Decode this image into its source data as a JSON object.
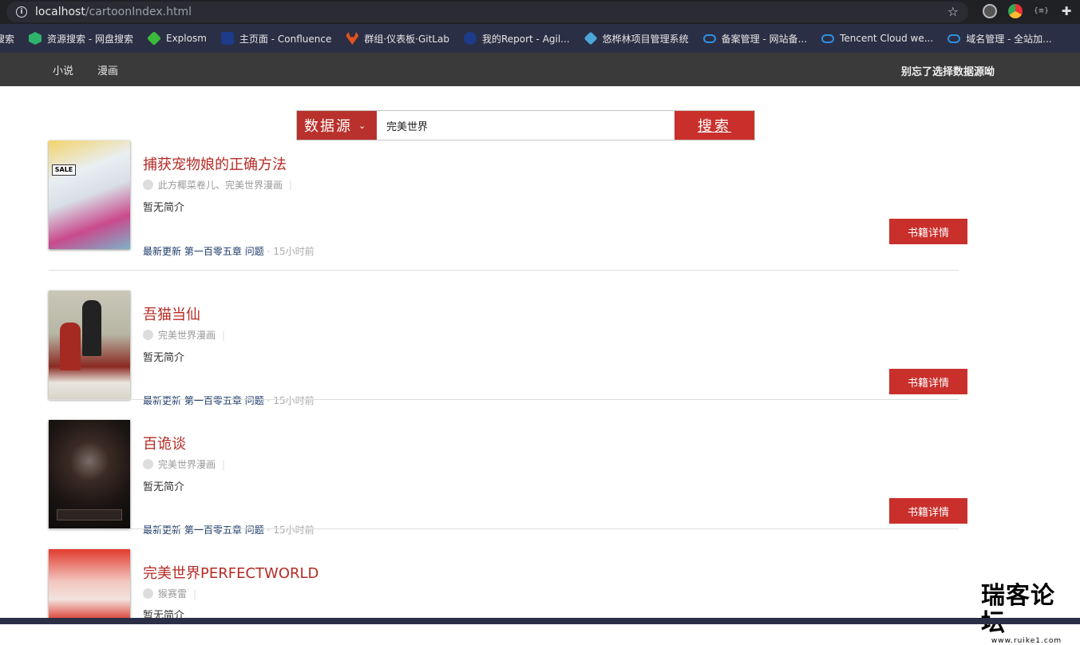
{
  "browser": {
    "host": "localhost",
    "path": "/cartoonIndex.html"
  },
  "bookmarks": [
    {
      "label": "搜索",
      "color": "#202124"
    },
    {
      "label": "资源搜索 - 网盘搜索",
      "color": "#2fb36a"
    },
    {
      "label": "Explosm",
      "color": "#3cba3c"
    },
    {
      "label": "主页面 - Confluence",
      "color": "#1d3b8a"
    },
    {
      "label": "群组·仪表板·GitLab",
      "color": "#e2531d"
    },
    {
      "label": "我的Report - Agil...",
      "color": "#1d3b8a"
    },
    {
      "label": "悠桦林项目管理系统",
      "color": "#4aa7d8"
    },
    {
      "label": "备案管理 - 网站备...",
      "color": "#2f8fe0"
    },
    {
      "label": "Tencent Cloud we...",
      "color": "#2f8fe0"
    },
    {
      "label": "域名管理 - 全站加...",
      "color": "#2f8fe0"
    }
  ],
  "nav": {
    "items": [
      "小说",
      "漫画"
    ],
    "right_text": "别忘了选择数据源呦"
  },
  "search": {
    "source_label": "数据源",
    "query": "完美世界",
    "button_label": "搜索"
  },
  "books": [
    {
      "title": "捕获宠物娘的正确方法",
      "author": "此方椰菜卷儿、完美世界漫画",
      "intro": "暂无简介",
      "update_label": "最新更新",
      "chapter": "第一百零五章",
      "chapter_title": "问题",
      "time": "15小时前",
      "detail_label": "书籍详情"
    },
    {
      "title": "吾猫当仙",
      "author": "完美世界漫画",
      "intro": "暂无简介",
      "update_label": "最新更新",
      "chapter": "第一百零五章",
      "chapter_title": "问题",
      "time": "15小时前",
      "detail_label": "书籍详情"
    },
    {
      "title": "百诡谈",
      "author": "完美世界漫画",
      "intro": "暂无简介",
      "update_label": "最新更新",
      "chapter": "第一百零五章",
      "chapter_title": "问题",
      "time": "15小时前",
      "detail_label": "书籍详情"
    },
    {
      "title": "完美世界PERFECTWORLD",
      "author": "猴赛雷",
      "intro": "暂无简介"
    }
  ],
  "watermark": {
    "big": "瑞客论坛",
    "small": "www.ruike1.com"
  }
}
